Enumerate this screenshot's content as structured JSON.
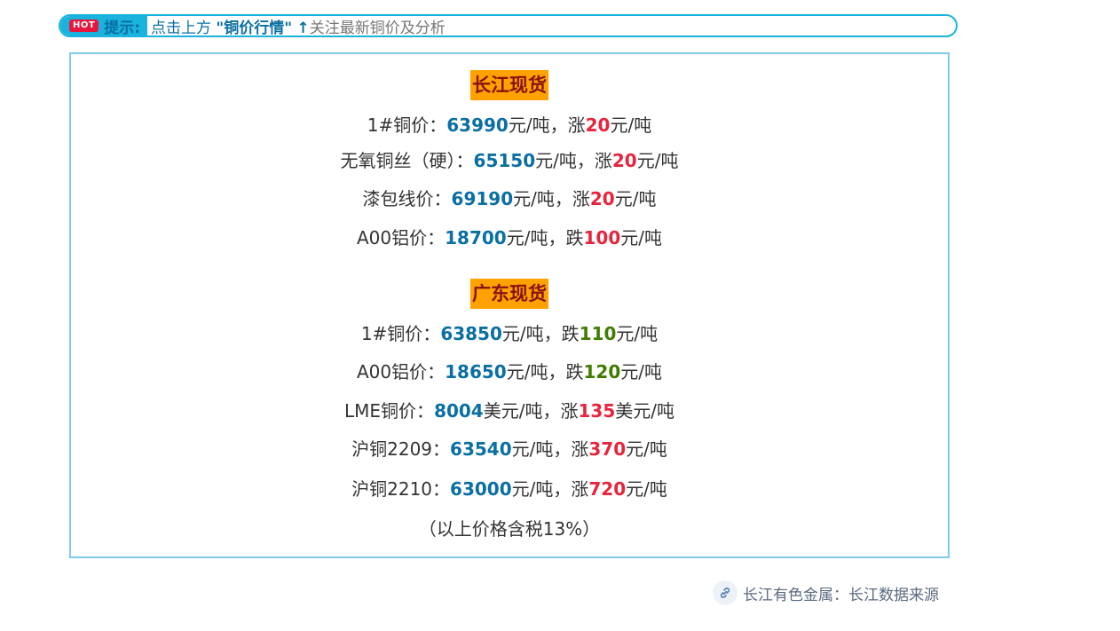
{
  "tip": {
    "hot_badge": "HOT",
    "label": "提示:",
    "text_a": "点击上方",
    "quote_open": "\"",
    "highlight": "铜价行情",
    "quote_close": "\"",
    "arrow": "↑",
    "text_b": "关注最新铜价及分析"
  },
  "changjiang": {
    "title": "长江现货",
    "rows": [
      {
        "label": "1#铜价：",
        "value": "63990",
        "unit": "元/吨，",
        "dir": "涨",
        "change": "20",
        "change_unit": "元/吨"
      },
      {
        "label": "无氧铜丝（硬）：",
        "value": "65150",
        "unit": "元/吨，",
        "dir": "涨",
        "change": "20",
        "change_unit": "元/吨"
      },
      {
        "label": "漆包线价：",
        "value": "69190",
        "unit": "元/吨，",
        "dir": "涨",
        "change": "20",
        "change_unit": "元/吨"
      },
      {
        "label": "A00铝价：",
        "value": "18700",
        "unit": "元/吨，",
        "dir": "跌",
        "change": "100",
        "change_unit": "元/吨"
      }
    ]
  },
  "guangdong": {
    "title": "广东现货",
    "rows": [
      {
        "label": "1#铜价：",
        "value": "63850",
        "unit": "元/吨，",
        "dir": "跌",
        "change": "110",
        "change_unit": "元/吨"
      },
      {
        "label": "A00铝价：",
        "value": "18650",
        "unit": "元/吨，",
        "dir": "跌",
        "change": "120",
        "change_unit": "元/吨"
      },
      {
        "label": "LME铜价：",
        "value": "8004",
        "unit": "美元/吨，",
        "dir": "涨",
        "change": "135",
        "change_unit": "美元/吨"
      },
      {
        "label": "沪铜2209：",
        "value": "63540",
        "unit": "元/吨，",
        "dir": "涨",
        "change": "370",
        "change_unit": "元/吨"
      },
      {
        "label": "沪铜2210：",
        "value": "63000",
        "unit": "元/吨，",
        "dir": "涨",
        "change": "720",
        "change_unit": "元/吨"
      }
    ],
    "note": "（以上价格含税13%）"
  },
  "source": {
    "icon": "link-icon",
    "text": "长江有色金属：长江数据来源"
  },
  "colors": {
    "accent": "#1ab3dd",
    "value": "#0a6fa3",
    "up": "#e8243c",
    "down": "#3f7c00",
    "title_bg": "#ffa200",
    "title_text": "#8a1010",
    "border": "#7ecbea"
  }
}
